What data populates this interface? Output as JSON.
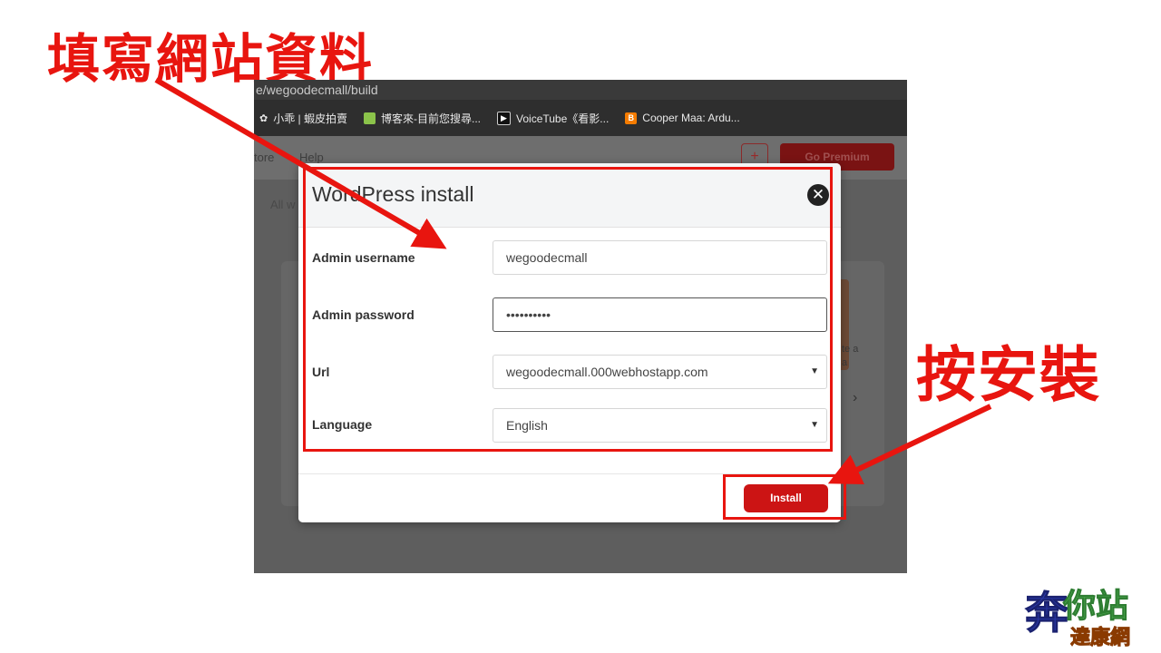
{
  "annotations": {
    "title_callout": "填寫網站資料",
    "install_callout": "按安裝"
  },
  "browser": {
    "url_fragment": "e/wegoodecmall/build",
    "bookmarks": [
      {
        "label": "小乖 | 蝦皮拍賣",
        "icon": "clover-icon",
        "color": "#e8e8e8"
      },
      {
        "label": "博客來-目前您搜尋...",
        "icon": "books-icon",
        "color": "#8bc34a"
      },
      {
        "label": "VoiceTube《看影...",
        "icon": "play-icon",
        "color": "#111111"
      },
      {
        "label": "Cooper Maa: Ardu...",
        "icon": "blogger-icon",
        "color": "#f57c00"
      }
    ]
  },
  "site": {
    "nav": [
      "tore",
      "Help"
    ],
    "plus_label": "+",
    "premium_label": "Go Premium",
    "all_label": "All w",
    "card_text": "te a\na",
    "card_chevron": "›"
  },
  "modal": {
    "title": "WordPress install",
    "close_symbol": "✕",
    "fields": [
      {
        "label": "Admin username",
        "value": "wegoodecmall"
      },
      {
        "label": "Admin password",
        "value": "••••••••••"
      },
      {
        "label": "Url",
        "value": "wegoodecmall.000webhostapp.com"
      },
      {
        "label": "Language",
        "value": "English"
      }
    ],
    "select_arrow": "▼",
    "install_label": "Install"
  },
  "colors": {
    "accent_red": "#e8150f",
    "install_red": "#cc1414"
  }
}
